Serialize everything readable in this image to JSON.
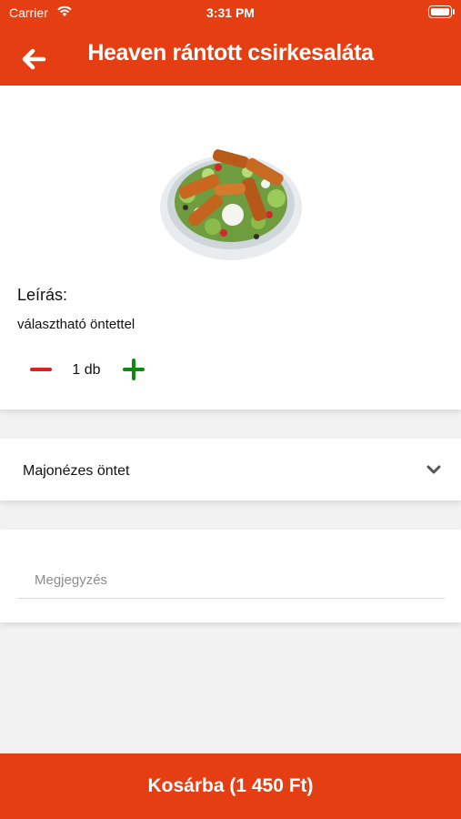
{
  "status_bar": {
    "carrier": "Carrier",
    "time": "3:31 PM"
  },
  "header": {
    "title": "Heaven rántott csirkesaláta",
    "back_icon": "arrow-left-icon"
  },
  "product": {
    "description_label": "Leírás:",
    "description": "választható öntettel",
    "quantity": "1 db"
  },
  "dressing": {
    "selected": "Majonézes öntet"
  },
  "notes": {
    "placeholder": "Megjegyzés"
  },
  "cart_button": {
    "label": "Kosárba (1 450 Ft)"
  },
  "colors": {
    "brand": "#e63e13",
    "minus": "#e02020",
    "plus": "#0f8a0f"
  }
}
